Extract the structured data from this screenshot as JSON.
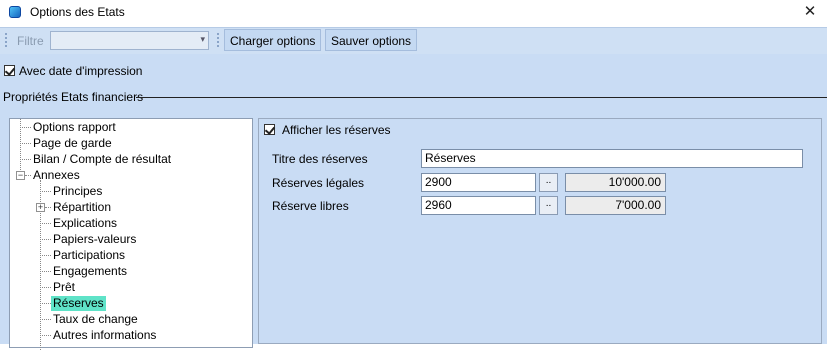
{
  "window": {
    "title": "Options des Etats",
    "close_symbol": "✕"
  },
  "toolbar": {
    "filter_label": "Filtre",
    "filter_value": "",
    "load_options_label": "Charger options",
    "save_options_label": "Sauver options"
  },
  "print_date": {
    "label": "Avec date d'impression",
    "checked": true
  },
  "section": {
    "title": "Propriétés Etats financiers"
  },
  "tree": {
    "items": [
      "Options rapport",
      "Page de garde",
      "Bilan / Compte de résultat",
      "Annexes",
      "Principes",
      "Répartition",
      "Explications",
      "Papiers-valeurs",
      "Participations",
      "Engagements",
      "Prêt",
      "Réserves",
      "Taux de change",
      "Autres informations"
    ],
    "selected": "Réserves"
  },
  "reserves": {
    "show_label": "Afficher les réserves",
    "show_checked": true,
    "title_label": "Titre des réserves",
    "title_value": "Réserves",
    "legal_label": "Réserves légales",
    "legal_account": "2900",
    "legal_amount": "10'000.00",
    "free_label": "Réserve libres",
    "free_account": "2960",
    "free_amount": "7'000.00",
    "browse_label": ".."
  },
  "colors": {
    "panel_background": "#c9dcf4",
    "selection_highlight": "#5fe3c8",
    "toolbar_background": "#cfe0f4"
  }
}
